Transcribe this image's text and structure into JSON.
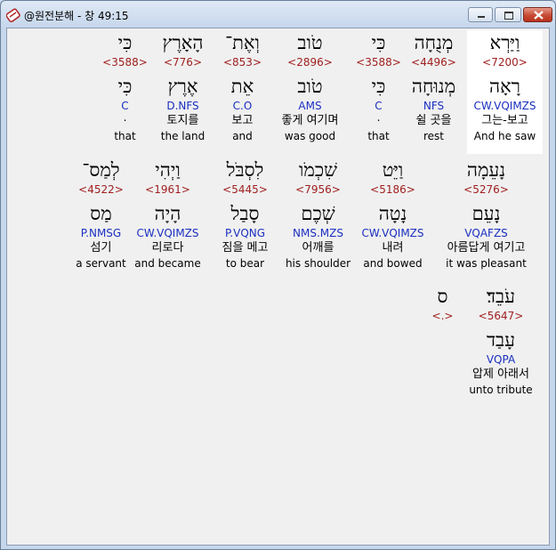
{
  "window": {
    "title": "@원전분해 - 창 49:15"
  },
  "rows": [
    {
      "words": [
        {
          "hebrew": "וַיַּרְא",
          "strong": "<7200>",
          "lemma": "רָאָה",
          "code": "CW.VQIMZS",
          "korean": "그는-보고",
          "english": "And he saw",
          "highlight": true
        },
        {
          "hebrew": "מְנֻחָה",
          "strong": "<4496>",
          "lemma": "מְנוּחָה",
          "code": "NFS",
          "korean": "쉴 곳을",
          "english": "rest"
        },
        {
          "hebrew": "כִּי",
          "strong": "<3588>",
          "lemma": "כִּי",
          "code": "C",
          "korean": ".",
          "english": "that"
        },
        {
          "hebrew": "טֹוב",
          "strong": "<2896>",
          "lemma": "טֹוב",
          "code": "AMS",
          "korean": "좋게 여기며",
          "english": "was good"
        },
        {
          "hebrew": "וְאֶת־",
          "strong": "<853>",
          "lemma": "אֵת",
          "code": "C.O",
          "korean": "보고",
          "english": "and"
        },
        {
          "hebrew": "הָאָרֶץ",
          "strong": "<776>",
          "lemma": "אֶרֶץ",
          "code": "D.NFS",
          "korean": "토지를",
          "english": "the land"
        },
        {
          "hebrew": "כִּי",
          "strong": "<3588>",
          "lemma": "כִּי",
          "code": "C",
          "korean": ".",
          "english": "that"
        }
      ]
    },
    {
      "words": [
        {
          "hebrew": "נָעֵמָה",
          "strong": "<5276>",
          "lemma": "נָעֵם",
          "code": "VQAFZS",
          "korean": "아름답게 여기고",
          "english": "it was pleasant"
        },
        {
          "hebrew": "וַיֵּט",
          "strong": "<5186>",
          "lemma": "נָטָה",
          "code": "CW.VQIMZS",
          "korean": "내려",
          "english": "and bowed"
        },
        {
          "hebrew": "שִׁכְמֹו",
          "strong": "<7956>",
          "lemma": "שְׁכֶם",
          "code": "NMS.MZS",
          "korean": "어깨를",
          "english": "his shoulder"
        },
        {
          "hebrew": "לִסְבֹּל",
          "strong": "<5445>",
          "lemma": "סָבַל",
          "code": "P.VQNG",
          "korean": "짐을 메고",
          "english": "to bear"
        },
        {
          "hebrew": "וַיְהִי",
          "strong": "<1961>",
          "lemma": "הָיָה",
          "code": "CW.VQIMZS",
          "korean": "리로다",
          "english": "and became"
        },
        {
          "hebrew": "לְמַס־",
          "strong": "<4522>",
          "lemma": "מַס",
          "code": "P.NMSG",
          "korean": "섬기",
          "english": "a servant"
        }
      ]
    },
    {
      "words": [
        {
          "hebrew": "עֹבֵד׃",
          "strong": "<5647>",
          "lemma": "עָבַד",
          "code": "VQPA",
          "korean": "압제 아래서",
          "english": "unto tribute"
        },
        {
          "hebrew": "ס",
          "strong": "<.>"
        }
      ]
    }
  ]
}
